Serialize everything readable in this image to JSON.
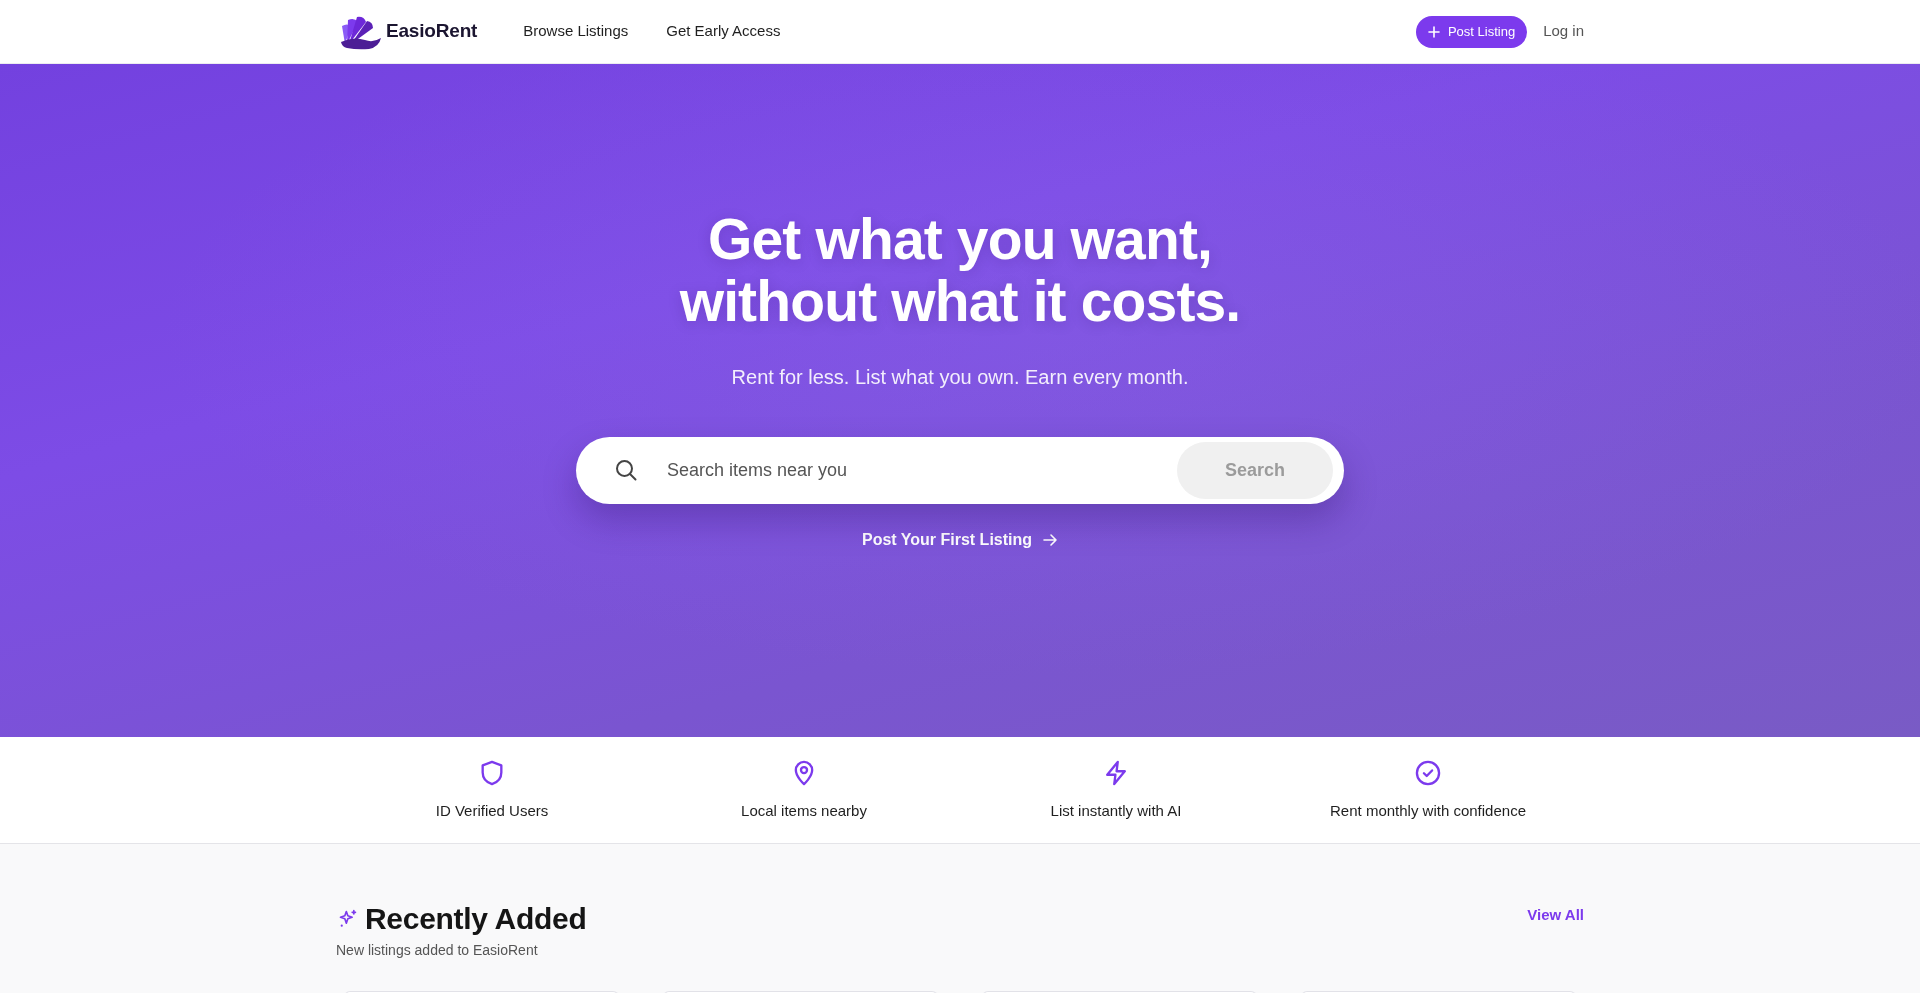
{
  "navbar": {
    "brand": "EasioRent",
    "links": [
      {
        "label": "Browse Listings"
      },
      {
        "label": "Get Early Access"
      }
    ],
    "post_listing": "Post Listing",
    "log_in": "Log in"
  },
  "hero": {
    "headline": "Get what you want, without what it costs.",
    "subtitle": "Rent for less. List what you own. Earn every month.",
    "search": {
      "placeholder": "Search items near you",
      "button": {
        "label": "Search",
        "disabled": true
      }
    },
    "cta": "Post Your First Listing"
  },
  "features": [
    {
      "label": "ID Verified Users"
    },
    {
      "label": "Local items nearby"
    },
    {
      "label": "List instantly with AI"
    },
    {
      "label": "Rent monthly with confidence"
    }
  ],
  "recently_added": {
    "title": "Recently Added",
    "subtitle": "New listings added to EasioRent",
    "view_all": "View All"
  }
}
